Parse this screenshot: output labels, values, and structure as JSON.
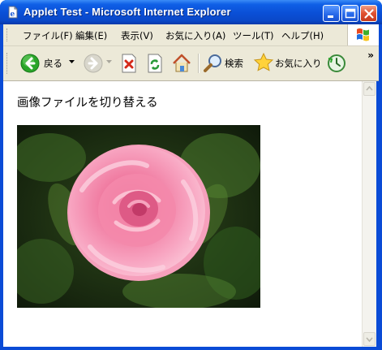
{
  "window": {
    "title": "Applet Test - Microsoft Internet Explorer",
    "controls": {
      "minimize_icon": "minimize-icon",
      "maximize_icon": "maximize-icon",
      "close_icon": "close-icon"
    }
  },
  "menubar": {
    "items": [
      {
        "label": "ファイル(F)"
      },
      {
        "label": "編集(E)"
      },
      {
        "label": "表示(V)"
      },
      {
        "label": "お気に入り(A)"
      },
      {
        "label": "ツール(T)"
      },
      {
        "label": "ヘルプ(H)"
      }
    ]
  },
  "toolbar": {
    "back_label": "戻る",
    "search_label": "検索",
    "favorites_label": "お気に入り",
    "overflow": "»"
  },
  "page": {
    "heading": "画像ファイルを切り替える"
  },
  "colors": {
    "titlebar": "#0a4fd6",
    "chrome": "#ece9d8",
    "back_green": "#2aa52a"
  }
}
